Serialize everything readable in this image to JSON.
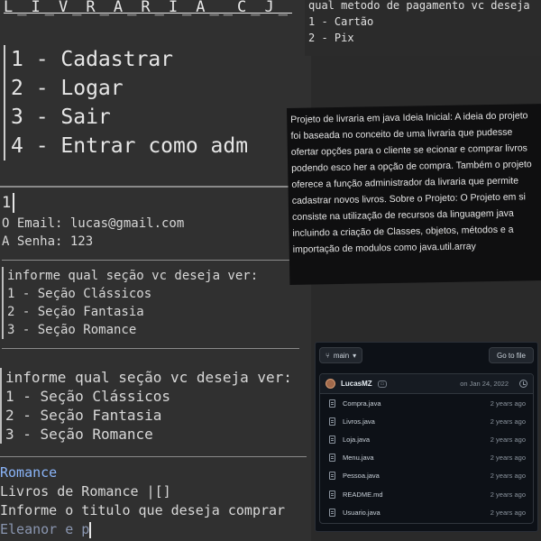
{
  "terminal": {
    "title": "L_I_V_R_A_R_I_A__C_J_",
    "menu": [
      "1 - Cadastrar",
      "2 - Logar",
      "3 - Sair",
      "4 - Entrar como adm"
    ],
    "input_value": "1",
    "email_line": "O Email: lucas@gmail.com",
    "senha_line": "A Senha: 123",
    "section_prompt": "informe qual seção vc deseja ver:",
    "sections": [
      "1 - Seção Clássicos",
      "2 - Seção Fantasia",
      "3 - Seção Romance"
    ],
    "section_prompt_2": "informe qual seção vc deseja ver:",
    "sections_2": [
      "1 - Seção Clássicos",
      "2 - Seção Fantasia",
      "3 - Seção Romance"
    ],
    "romance_label": "Romance",
    "romance_books": "Livros de Romance |[]",
    "title_prompt": "Informe o titulo que deseja comprar",
    "title_input": "Eleanor e p"
  },
  "payment": {
    "question": "qual metodo de pagamento vc deseja",
    "options": [
      "1 - Cartão",
      "2 - Pix"
    ]
  },
  "description": {
    "text": "Projeto de livraria em java Ideia Inicial: A ideia do projeto foi baseada no conceito de uma livraria que pudesse ofertar opções para o cliente se ecionar e comprar livros podendo esco her a opção de compra. Também o projeto oferece a função administrador da livraria que permite cadastrar novos livros. Sobre o Projeto: O Projeto em si consiste na utilização de recursos da linguagem java incluindo a criação de Classes, objetos, métodos e a importação de modulos como java.util.array"
  },
  "repo": {
    "branch": "main",
    "goto_file": "Go to file",
    "author": "LucasMZ",
    "commit_date": "on Jan 24, 2022",
    "files": [
      {
        "name": "Compra.java",
        "age": "2 years ago"
      },
      {
        "name": "Livros.java",
        "age": "2 years ago"
      },
      {
        "name": "Loja.java",
        "age": "2 years ago"
      },
      {
        "name": "Menu.java",
        "age": "2 years ago"
      },
      {
        "name": "Pessoa.java",
        "age": "2 years ago"
      },
      {
        "name": "README.md",
        "age": "2 years ago"
      },
      {
        "name": "Usuario.java",
        "age": "2 years ago"
      }
    ]
  }
}
